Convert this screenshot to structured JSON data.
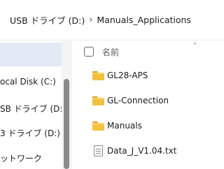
{
  "breadcrumb": {
    "drive": "USB ドライブ (D:)",
    "separator": "›",
    "folder": "Manuals_Applications"
  },
  "nav": {
    "items": [
      {
        "label": "ocal Disk (C:)"
      },
      {
        "label": "SB ドライブ (D:)"
      },
      {
        "label": "3 ドライブ (D:)"
      },
      {
        "label": "ットワーク"
      }
    ]
  },
  "header": {
    "name_column": "名前",
    "sort_icon": "chevron-up-icon"
  },
  "files": [
    {
      "name": "GL28-APS",
      "type": "folder"
    },
    {
      "name": "GL-Connection",
      "type": "folder"
    },
    {
      "name": "Manuals",
      "type": "folder"
    },
    {
      "name": "Data_J_V1.04.txt",
      "type": "text-file"
    }
  ],
  "colors": {
    "selected_bg": "#e2eaf5",
    "folder": "#f3c23d"
  }
}
